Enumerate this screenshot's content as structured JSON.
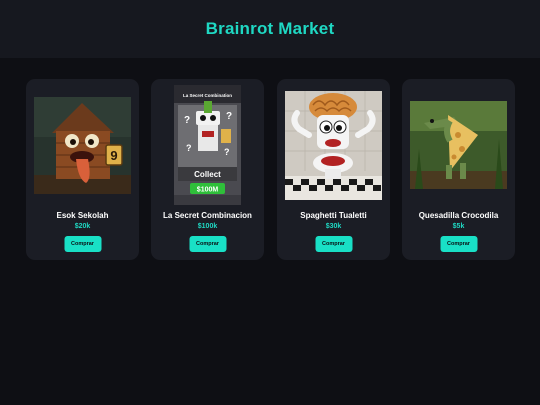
{
  "header": {
    "title": "Brainrot Market"
  },
  "products": [
    {
      "name": "Esok Sekolah",
      "price": "$20k",
      "button": "Comprar",
      "image": "hut-creature-image"
    },
    {
      "name": "La Secret Combinacion",
      "price": "$100k",
      "button": "Comprar",
      "image": "secret-card-image",
      "image_text": {
        "heading": "La Secret Combination",
        "collect": "Collect",
        "amount": "$100M"
      }
    },
    {
      "name": "Spaghetti Tualetti",
      "price": "$30k",
      "button": "Comprar",
      "image": "spaghetti-toilet-image"
    },
    {
      "name": "Quesadilla Crocodila",
      "price": "$5k",
      "button": "Comprar",
      "image": "quesadilla-croc-image"
    }
  ],
  "colors": {
    "accent": "#1fd8c3",
    "button": "#19e0c6",
    "card": "#1b1d25",
    "background": "#0e0f14",
    "header": "#16181f"
  }
}
